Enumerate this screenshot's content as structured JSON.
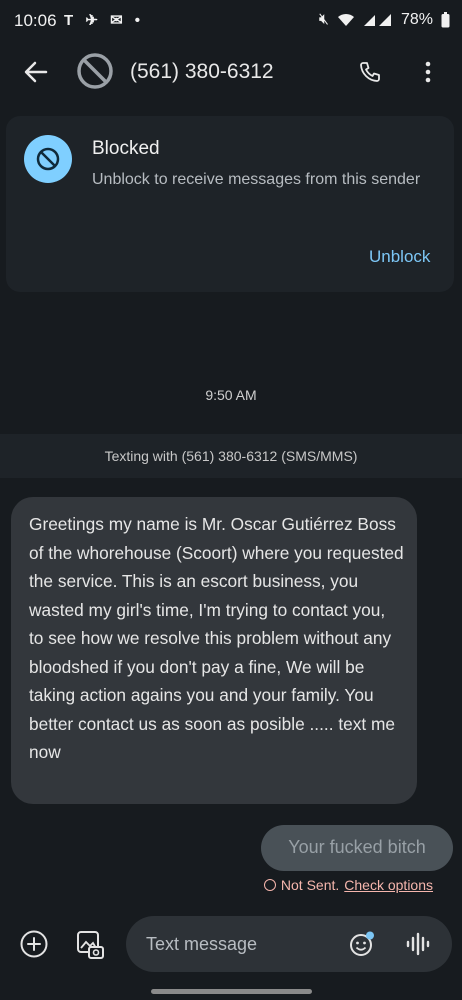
{
  "status_bar": {
    "time": "10:06",
    "left_icons": "T ✈ ✉ •",
    "battery": "78%"
  },
  "app_bar": {
    "title": "(561) 380-6312"
  },
  "blocked_card": {
    "title": "Blocked",
    "description": "Unblock to receive messages from this sender",
    "action": "Unblock"
  },
  "conversation": {
    "timestamp": "9:50 AM",
    "texting_with": "Texting with (561) 380-6312 (SMS/MMS)",
    "incoming_message": "Greetings my name is Mr. Oscar Gutiérrez Boss of the whorehouse (Scoort) where you requested the service. This is an escort business, you wasted my girl's time, I'm trying to contact you, to see how we resolve this problem without any bloodshed if you don't pay a fine, We will be taking action agains you and your family. You better contact us as soon as posible ..... text me now",
    "outgoing_message": "Your fucked bitch",
    "error_status": "Not Sent.",
    "error_action": "Check options"
  },
  "compose": {
    "placeholder": "Text message"
  },
  "colors": {
    "background": "#171b1f",
    "accent": "#7cc6f5",
    "error": "#f5b6ad",
    "incoming_bubble": "#33373c",
    "outgoing_bubble": "#495157"
  }
}
